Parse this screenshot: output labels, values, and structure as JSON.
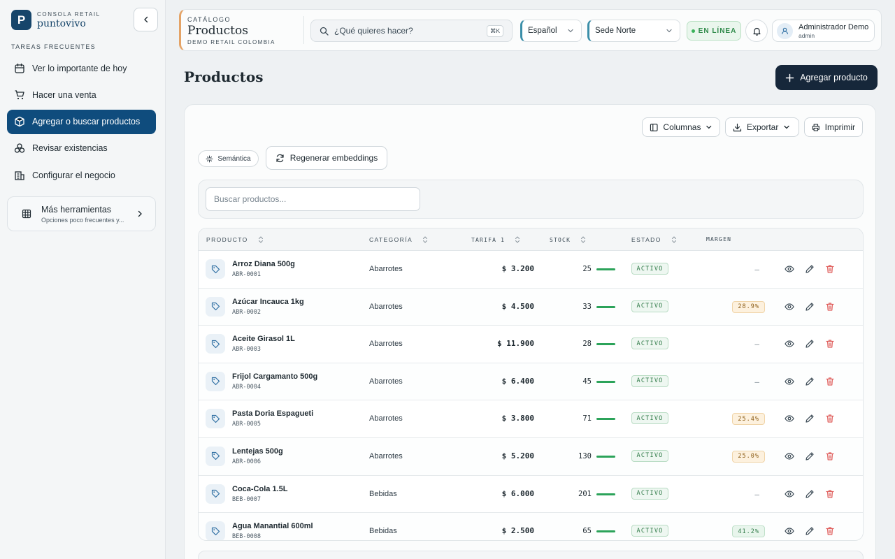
{
  "brand": {
    "small": "CONSOLA RETAIL",
    "name": "puntovivo",
    "logo_letter": "P"
  },
  "sidebar": {
    "section_label": "TAREAS FRECUENTES",
    "items": [
      {
        "label": "Ver lo importante de hoy",
        "icon": "calendar-icon",
        "active": false
      },
      {
        "label": "Hacer una venta",
        "icon": "cart-icon",
        "active": false
      },
      {
        "label": "Agregar o buscar productos",
        "icon": "package-search-icon",
        "active": true
      },
      {
        "label": "Revisar existencias",
        "icon": "boxes-icon",
        "active": false
      },
      {
        "label": "Configurar el negocio",
        "icon": "building-icon",
        "active": false
      }
    ],
    "more": {
      "title": "Más herramientas",
      "subtitle": "Opciones poco frecuentes y..."
    }
  },
  "topbar": {
    "eyebrow": "CATÁLOGO",
    "title": "Productos",
    "subtitle": "DEMO RETAIL COLOMBIA",
    "search_placeholder": "¿Qué quieres hacer?",
    "shortcut": "⌘K",
    "language": "Español",
    "branch": "Sede Norte",
    "status": "EN LÍNEA",
    "user_name": "Administrador Demo",
    "user_role": "admin"
  },
  "page": {
    "title": "Productos",
    "add_button": "Agregar producto"
  },
  "toolbar": {
    "columns": "Columnas",
    "export": "Exportar",
    "print": "Imprimir",
    "semantic": "Semántica",
    "regenerate": "Regenerar embeddings"
  },
  "filter": {
    "placeholder": "Buscar productos..."
  },
  "table": {
    "headers": {
      "product": "PRODUCTO",
      "category": "CATEGORÍA",
      "tariff": "TARIFA 1",
      "stock": "STOCK",
      "status": "ESTADO",
      "margin": "MARGEN"
    },
    "rows": [
      {
        "name": "Arroz Diana 500g",
        "sku": "ABR-0001",
        "category": "Abarrotes",
        "price": "$ 3.200",
        "stock": "25",
        "stock_level": 1.0,
        "status": "ACTIVO",
        "margin": "—",
        "margin_kind": "none"
      },
      {
        "name": "Azúcar Incauca 1kg",
        "sku": "ABR-0002",
        "category": "Abarrotes",
        "price": "$ 4.500",
        "stock": "33",
        "stock_level": 1.0,
        "status": "ACTIVO",
        "margin": "28.9%",
        "margin_kind": "amber"
      },
      {
        "name": "Aceite Girasol 1L",
        "sku": "ABR-0003",
        "category": "Abarrotes",
        "price": "$ 11.900",
        "stock": "28",
        "stock_level": 1.0,
        "status": "ACTIVO",
        "margin": "—",
        "margin_kind": "none"
      },
      {
        "name": "Frijol Cargamanto 500g",
        "sku": "ABR-0004",
        "category": "Abarrotes",
        "price": "$ 6.400",
        "stock": "45",
        "stock_level": 1.0,
        "status": "ACTIVO",
        "margin": "—",
        "margin_kind": "none"
      },
      {
        "name": "Pasta Doria Espagueti",
        "sku": "ABR-0005",
        "category": "Abarrotes",
        "price": "$ 3.800",
        "stock": "71",
        "stock_level": 1.0,
        "status": "ACTIVO",
        "margin": "25.4%",
        "margin_kind": "amber"
      },
      {
        "name": "Lentejas 500g",
        "sku": "ABR-0006",
        "category": "Abarrotes",
        "price": "$ 5.200",
        "stock": "130",
        "stock_level": 1.0,
        "status": "ACTIVO",
        "margin": "25.0%",
        "margin_kind": "amber"
      },
      {
        "name": "Coca-Cola 1.5L",
        "sku": "BEB-0007",
        "category": "Bebidas",
        "price": "$ 6.000",
        "stock": "201",
        "stock_level": 1.0,
        "status": "ACTIVO",
        "margin": "—",
        "margin_kind": "none"
      },
      {
        "name": "Agua Manantial 600ml",
        "sku": "BEB-0008",
        "category": "Bebidas",
        "price": "$ 2.500",
        "stock": "65",
        "stock_level": 1.0,
        "status": "ACTIVO",
        "margin": "41.2%",
        "margin_kind": "green"
      }
    ]
  }
}
